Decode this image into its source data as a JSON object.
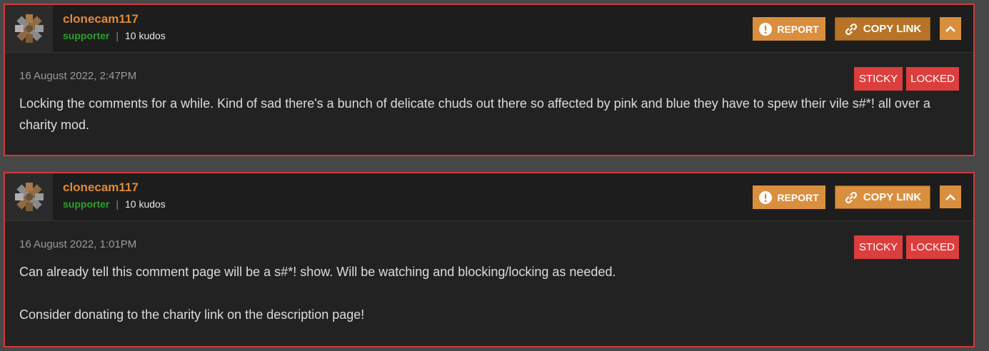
{
  "comments": [
    {
      "author": "clonecam117",
      "role": "supporter",
      "separator": "|",
      "kudos": "10 kudos",
      "report_label": "REPORT",
      "copy_link_label": "COPY LINK",
      "timestamp": "16 August 2022, 2:47PM",
      "badges": [
        "STICKY",
        "LOCKED"
      ],
      "paragraphs": [
        "Locking the comments for a while. Kind of sad there's a bunch of delicate chuds out there so affected by pink and blue they have to spew their vile s#*! all over a charity mod."
      ]
    },
    {
      "author": "clonecam117",
      "role": "supporter",
      "separator": "|",
      "kudos": "10 kudos",
      "report_label": "REPORT",
      "copy_link_label": "COPY LINK",
      "timestamp": "16 August 2022, 1:01PM",
      "badges": [
        "STICKY",
        "LOCKED"
      ],
      "paragraphs": [
        "Can already tell this comment page will be a s#*! show. Will be watching and blocking/locking as needed.",
        "Consider donating to the charity link on the description page!"
      ]
    }
  ],
  "colors": {
    "page_background": "#474747",
    "card_background": "#222222",
    "card_border": "#d03a3a",
    "author_name": "#e0893a",
    "role_supporter": "#2aa12a",
    "button_orange": "#d98f3e",
    "badge_red": "#dc3e3e"
  },
  "icons": {
    "report": "exclamation-circle-icon",
    "copy_link": "link-icon",
    "collapse": "chevron-up-icon",
    "avatar": "crossed-tools-avatar"
  }
}
